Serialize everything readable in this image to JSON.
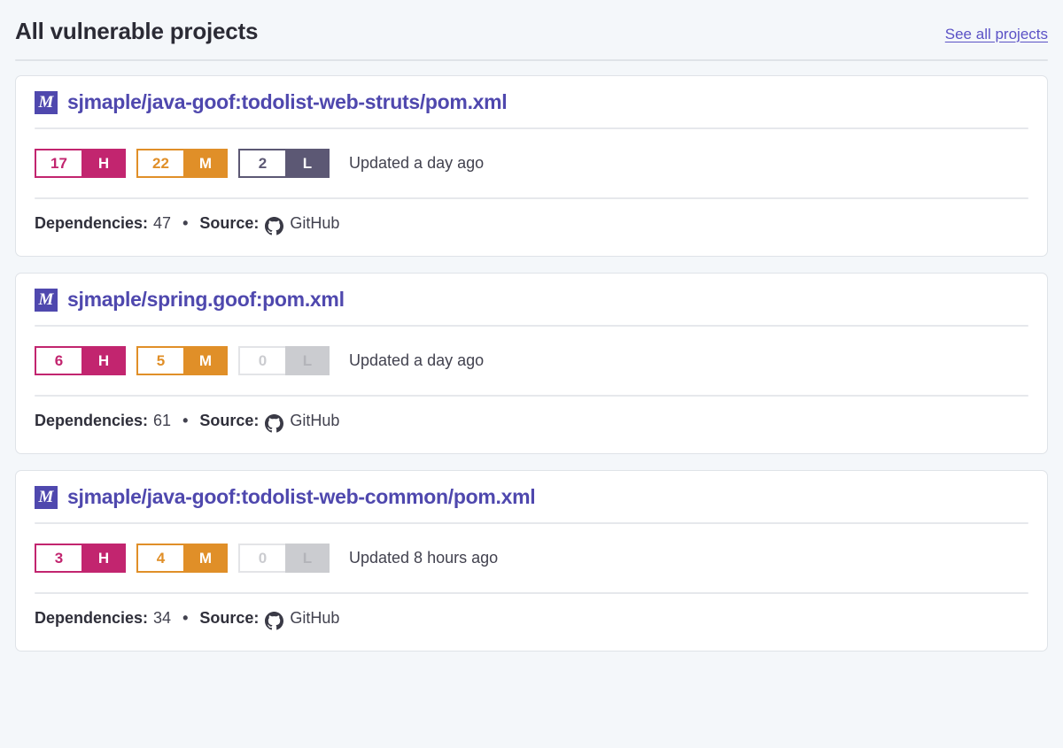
{
  "header": {
    "title": "All vulnerable projects",
    "see_all_label": "See all projects"
  },
  "severity_legend": {
    "high_letter": "H",
    "medium_letter": "M",
    "low_letter": "L"
  },
  "labels": {
    "dependencies_label": "Dependencies:",
    "source_label": "Source:",
    "separator": "•"
  },
  "colors": {
    "page_background": "#f4f7fa",
    "card_background": "#ffffff",
    "card_border": "#dfe3e8",
    "brand_purple": "#4f48ae",
    "link_purple": "#5b52c6",
    "severity_high": "#c2256f",
    "severity_medium": "#e08f28",
    "severity_low": "#5c5874",
    "severity_empty": "#cbccd0",
    "text_dark": "#2b2b35",
    "text_body": "#42424f"
  },
  "projects": [
    {
      "type_badge": "M",
      "type_icon": "maven-icon",
      "name": "sjmaple/java-goof:todolist-web-struts/pom.xml",
      "high": "17",
      "medium": "22",
      "low": "2",
      "updated": "Updated a day ago",
      "dependencies": "47",
      "source": "GitHub",
      "source_icon": "github-icon"
    },
    {
      "type_badge": "M",
      "type_icon": "maven-icon",
      "name": "sjmaple/spring.goof:pom.xml",
      "high": "6",
      "medium": "5",
      "low": "0",
      "updated": "Updated a day ago",
      "dependencies": "61",
      "source": "GitHub",
      "source_icon": "github-icon"
    },
    {
      "type_badge": "M",
      "type_icon": "maven-icon",
      "name": "sjmaple/java-goof:todolist-web-common/pom.xml",
      "high": "3",
      "medium": "4",
      "low": "0",
      "updated": "Updated 8 hours ago",
      "dependencies": "34",
      "source": "GitHub",
      "source_icon": "github-icon"
    }
  ]
}
